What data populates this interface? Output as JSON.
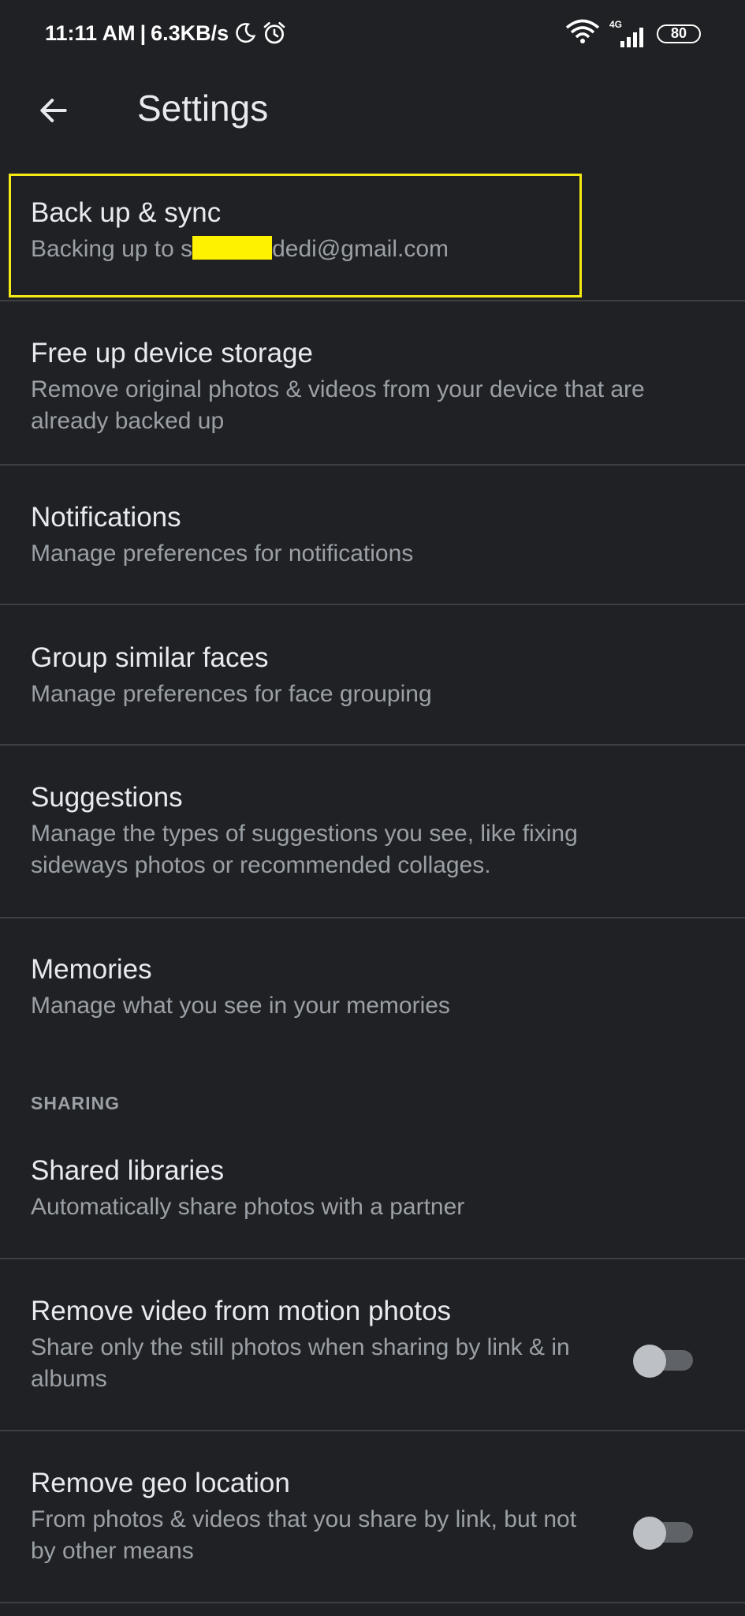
{
  "status_bar": {
    "time": "11:11 AM",
    "separator": "|",
    "speed": "6.3KB/s",
    "network_type": "4G",
    "battery": "80",
    "icons": [
      "moon-icon",
      "alarm-icon",
      "wifi-icon",
      "signal-icon",
      "battery-icon"
    ]
  },
  "app_bar": {
    "title": "Settings",
    "back_icon": "arrow-back-icon"
  },
  "items": {
    "backup": {
      "title": "Back up & sync",
      "subtitle_prefix": "Backing up to s",
      "subtitle_suffix": "dedi@gmail.com"
    },
    "free_up": {
      "title": "Free up device storage",
      "subtitle": "Remove original photos & videos from your device that are already backed up"
    },
    "notifications": {
      "title": "Notifications",
      "subtitle": "Manage preferences for notifications"
    },
    "faces": {
      "title": "Group similar faces",
      "subtitle": "Manage preferences for face grouping"
    },
    "suggestions": {
      "title": "Suggestions",
      "subtitle": "Manage the types of suggestions you see, like fixing sideways photos or recommended collages."
    },
    "memories": {
      "title": "Memories",
      "subtitle": "Manage what you see in your memories"
    },
    "sharing_header": "SHARING",
    "shared_libraries": {
      "title": "Shared libraries",
      "subtitle": "Automatically share photos with a partner"
    },
    "motion_video": {
      "title": "Remove video from motion photos",
      "subtitle": "Share only the still photos when sharing by link & in albums",
      "toggle_on": false
    },
    "geo_location": {
      "title": "Remove geo location",
      "subtitle": "From photos & videos that you share by link, but not by other means",
      "toggle_on": false
    }
  },
  "colors": {
    "background": "#202124",
    "primary_text": "#e8eaed",
    "secondary_text": "#9aa0a6",
    "highlight_border": "#f5ea14",
    "redaction": "#fff200"
  }
}
